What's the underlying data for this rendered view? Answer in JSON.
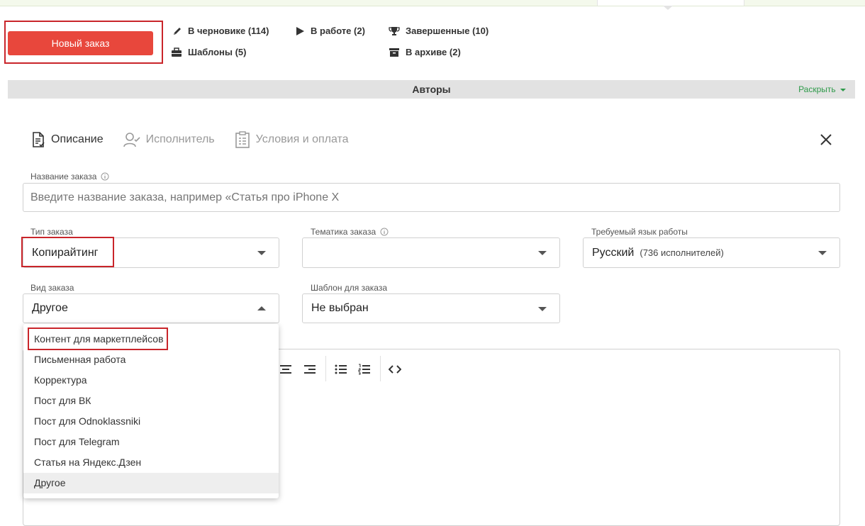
{
  "colors": {
    "accent_red": "#e8473c",
    "highlight_red": "#c9252a",
    "link_green": "#2e9a4a"
  },
  "header": {
    "new_order_label": "Новый заказ",
    "nav": [
      {
        "icon": "pencil-icon",
        "label": "В черновике (114)"
      },
      {
        "icon": "play-icon",
        "label": "В работе (2)"
      },
      {
        "icon": "trophy-icon",
        "label": "Завершенные (10)"
      },
      {
        "icon": "briefcase-icon",
        "label": "Шаблоны (5)"
      },
      {
        "icon": "archive-icon",
        "label": "В архиве (2)"
      }
    ]
  },
  "authors_bar": {
    "title": "Авторы",
    "expand_label": "Раскрыть"
  },
  "tabs": [
    {
      "icon": "document-icon",
      "label": "Описание",
      "active": true
    },
    {
      "icon": "user-check-icon",
      "label": "Исполнитель",
      "active": false
    },
    {
      "icon": "clipboard-icon",
      "label": "Условия и оплата",
      "active": false
    }
  ],
  "form": {
    "order_name": {
      "label": "Название заказа",
      "placeholder": "Введите название заказа, например «Статья про iPhone X"
    },
    "order_type": {
      "label": "Тип заказа",
      "value": "Копирайтинг"
    },
    "topic": {
      "label": "Тематика заказа",
      "value": ""
    },
    "language": {
      "label": "Требуемый язык работы",
      "value": "Русский",
      "sub": "(736 исполнителей)"
    },
    "kind": {
      "label": "Вид заказа",
      "value": "Другое"
    },
    "template": {
      "label": "Шаблон для заказа",
      "value": "Не выбран"
    }
  },
  "kind_options": [
    "Контент для маркетплейсов",
    "Письменная работа",
    "Корректура",
    "Пост для ВК",
    "Пост для Odnoklassniki",
    "Пост для Telegram",
    "Статья на Яндекс.Дзен",
    "Другое"
  ],
  "kind_selected": "Другое"
}
